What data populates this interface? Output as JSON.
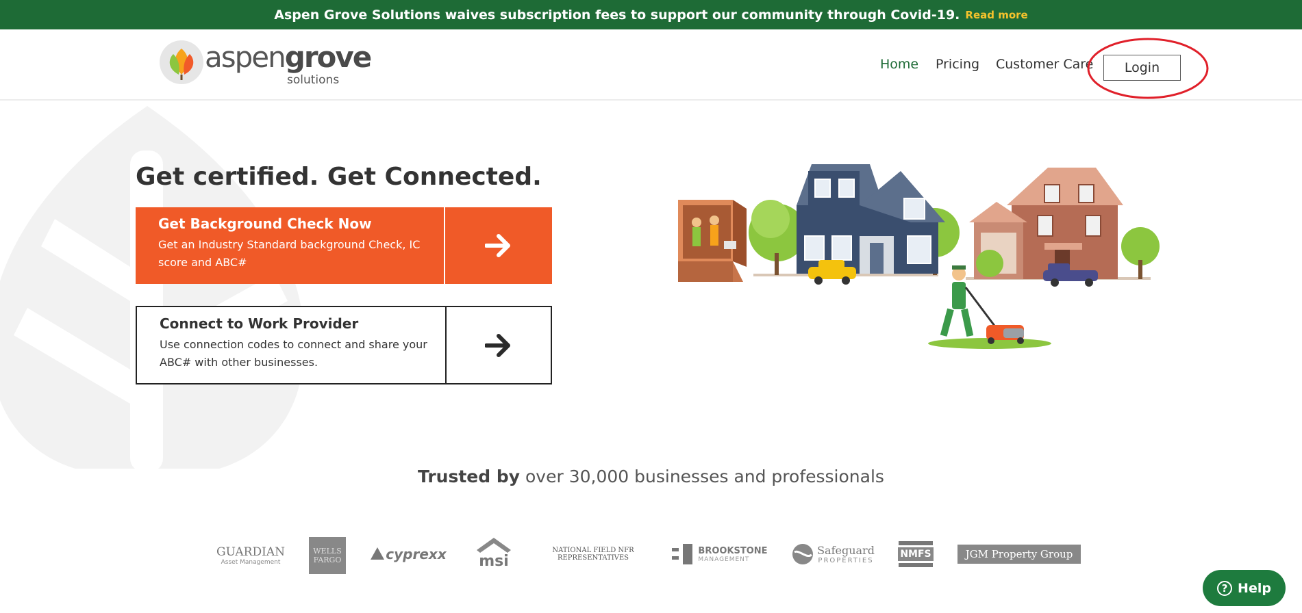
{
  "banner": {
    "message": "Aspen Grove Solutions waives subscription fees to support our community through Covid-19.",
    "link": "Read more"
  },
  "header": {
    "logo_main": "aspen",
    "logo_bold": "grove",
    "logo_sub": "solutions",
    "nav": {
      "home": "Home",
      "pricing": "Pricing",
      "customer_care": "Customer Care",
      "login": "Login"
    }
  },
  "hero": {
    "title": "Get certified. Get Connected.",
    "background_check": {
      "title": "Get Background Check Now",
      "desc": "Get an Industry Standard background Check, IC score and ABC#",
      "icon": "arrow-right-icon"
    },
    "connect": {
      "title": "Connect to Work Provider",
      "desc": "Use connection codes to connect and share your ABC# with other businesses.",
      "icon": "arrow-right-icon"
    }
  },
  "trusted": {
    "bold": "Trusted by",
    "rest": "over 30,000 businesses and professionals"
  },
  "partners": {
    "guardian": "GUARDIAN",
    "guardian_sub": "Asset Management",
    "wells_fargo": "WELLS FARGO",
    "cyprexx": "cyprexx",
    "msi": "msi",
    "nfr": "NATIONAL FIELD NFR REPRESENTATIVES",
    "brookstone": "BROOKSTONE",
    "brookstone_sub": "MANAGEMENT",
    "safeguard": "Safeguard",
    "safeguard_sub": "PROPERTIES",
    "nmfs": "NMFS",
    "jgm": "JGM Property Group"
  },
  "help": {
    "label": "Help",
    "icon": "question-circle-icon"
  },
  "colors": {
    "brand_green": "#1e6b36",
    "accent_orange": "#f05a28",
    "banner_link": "#f5c32c",
    "annotation_red": "#e0202a"
  }
}
